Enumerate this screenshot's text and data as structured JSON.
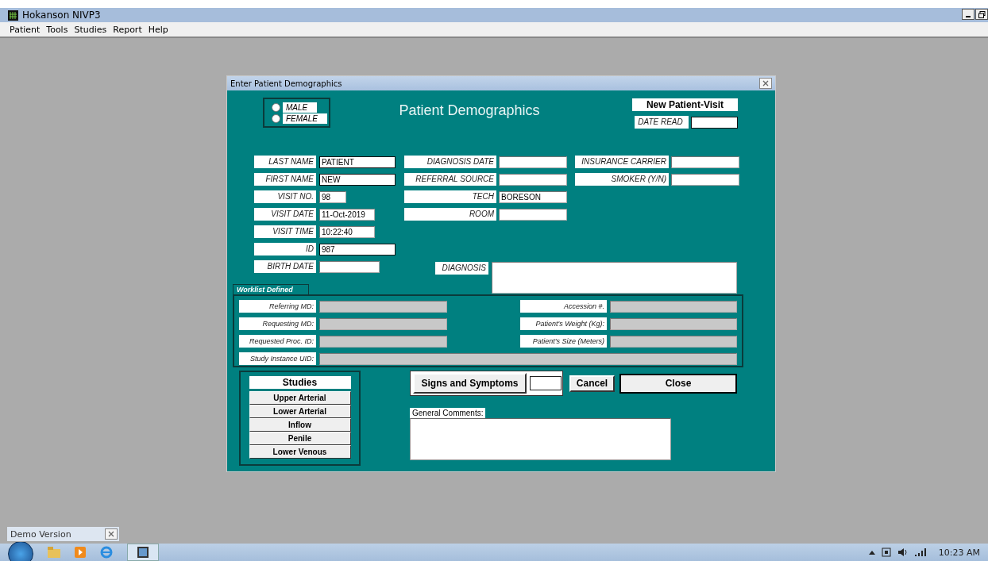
{
  "window": {
    "title": "Hokanson NIVP3"
  },
  "menu": [
    "Patient",
    "Tools",
    "Studies",
    "Report",
    "Help"
  ],
  "dialog": {
    "title": "Enter Patient Demographics",
    "heading": "Patient Demographics",
    "gender": [
      {
        "label": "MALE",
        "selected": false
      },
      {
        "label": "FEMALE",
        "selected": false
      }
    ],
    "visit_type": "New Patient-Visit",
    "date_read": {
      "label": "DATE READ"
    },
    "column_1": [
      {
        "label": "LAST NAME",
        "value": "PATIENT"
      },
      {
        "label": "FIRST NAME",
        "value": "NEW"
      },
      {
        "label": "VISIT NO.",
        "value": "98"
      },
      {
        "label": "VISIT DATE",
        "value": "11-Oct-2019"
      },
      {
        "label": "VISIT TIME",
        "value": "10:22:40"
      },
      {
        "label": "ID",
        "value": "987"
      },
      {
        "label": "BIRTH DATE"
      }
    ],
    "column_2": [
      {
        "label": "DIAGNOSIS DATE"
      },
      {
        "label": "REFERRAL SOURCE"
      },
      {
        "label": "TECH",
        "value": "BORESON"
      },
      {
        "label": "ROOM"
      }
    ],
    "column_3": [
      {
        "label": "INSURANCE CARRIER"
      },
      {
        "label": "SMOKER (Y/N)"
      }
    ],
    "diagnosis": {
      "label": "DIAGNOSIS"
    },
    "worklist": {
      "title": "Worklist Defined",
      "left": [
        {
          "label": "Referring MD:",
          "disabled": true
        },
        {
          "label": "Requesting MD:",
          "disabled": true
        },
        {
          "label": "Requested Proc. ID:",
          "disabled": true
        }
      ],
      "right": [
        {
          "label": "Accession #.",
          "disabled": true
        },
        {
          "label": "Patient's Weight (Kg):",
          "disabled": true
        },
        {
          "label": "Patient's Size (Meters)",
          "disabled": true
        }
      ],
      "uid": {
        "label": "Study Instance UID:",
        "disabled": true
      }
    },
    "studies": {
      "title": "Studies",
      "buttons": [
        "Upper Arterial",
        "Lower Arterial",
        "Inflow",
        "Penile",
        "Lower Venous"
      ]
    },
    "signs_button": "Signs and Symptoms",
    "cancel_button": "Cancel",
    "close_button": "Close",
    "comments": {
      "label": "General Comments:"
    }
  },
  "minimized_window": {
    "title": "Demo Version"
  },
  "taskbar": {
    "clock": "10:23 AM"
  }
}
